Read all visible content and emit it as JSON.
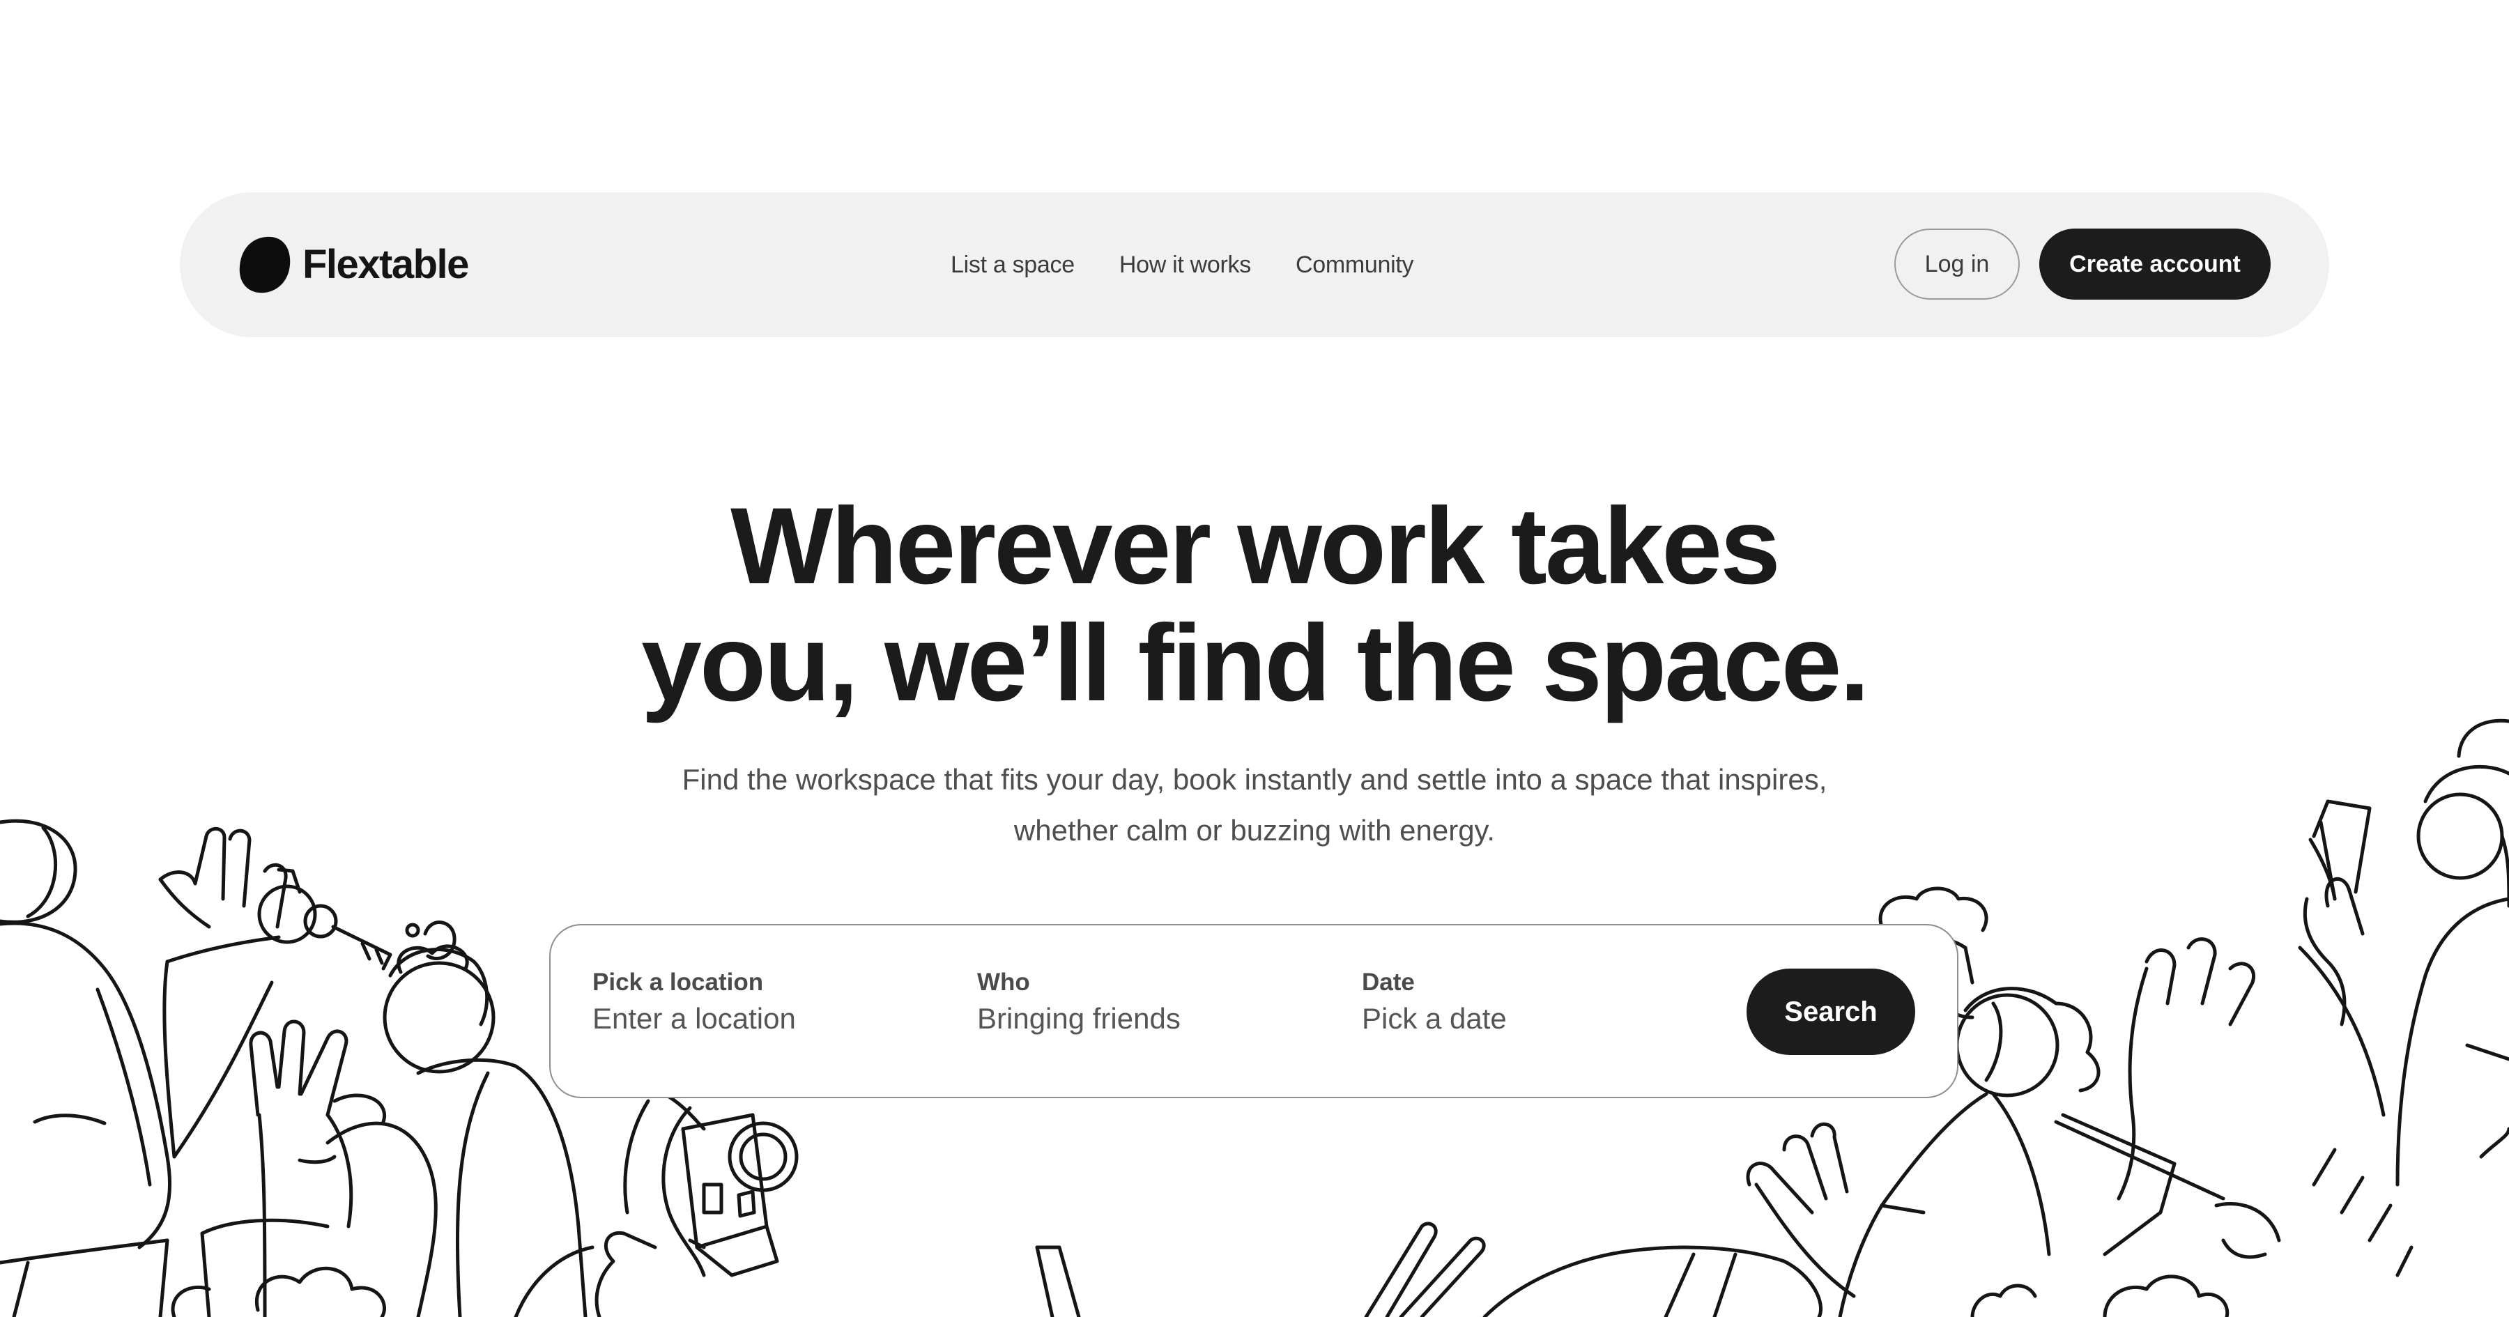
{
  "brand": {
    "name": "Flextable",
    "logo_icon": "flextable-blob-logo"
  },
  "nav": {
    "links": [
      {
        "label": "List a space"
      },
      {
        "label": "How it works"
      },
      {
        "label": "Community"
      }
    ],
    "login_label": "Log in",
    "create_account_label": "Create account"
  },
  "hero": {
    "title_line1": "Wherever work takes",
    "title_line2": "you, we’ll find the space.",
    "subtitle_line1": "Find the workspace that fits your day, book instantly and settle into a space that inspires,",
    "subtitle_line2": "whether calm or buzzing with energy."
  },
  "search": {
    "location": {
      "label": "Pick a location",
      "placeholder": "Enter a location"
    },
    "who": {
      "label": "Who",
      "placeholder": "Bringing friends"
    },
    "date": {
      "label": "Date",
      "placeholder": "Pick a date"
    },
    "button_label": "Search"
  },
  "colors": {
    "background": "#ffffff",
    "nav_background": "#f1f1f1",
    "primary_dark": "#1c1c1c",
    "text_muted": "#4e4e4e"
  }
}
